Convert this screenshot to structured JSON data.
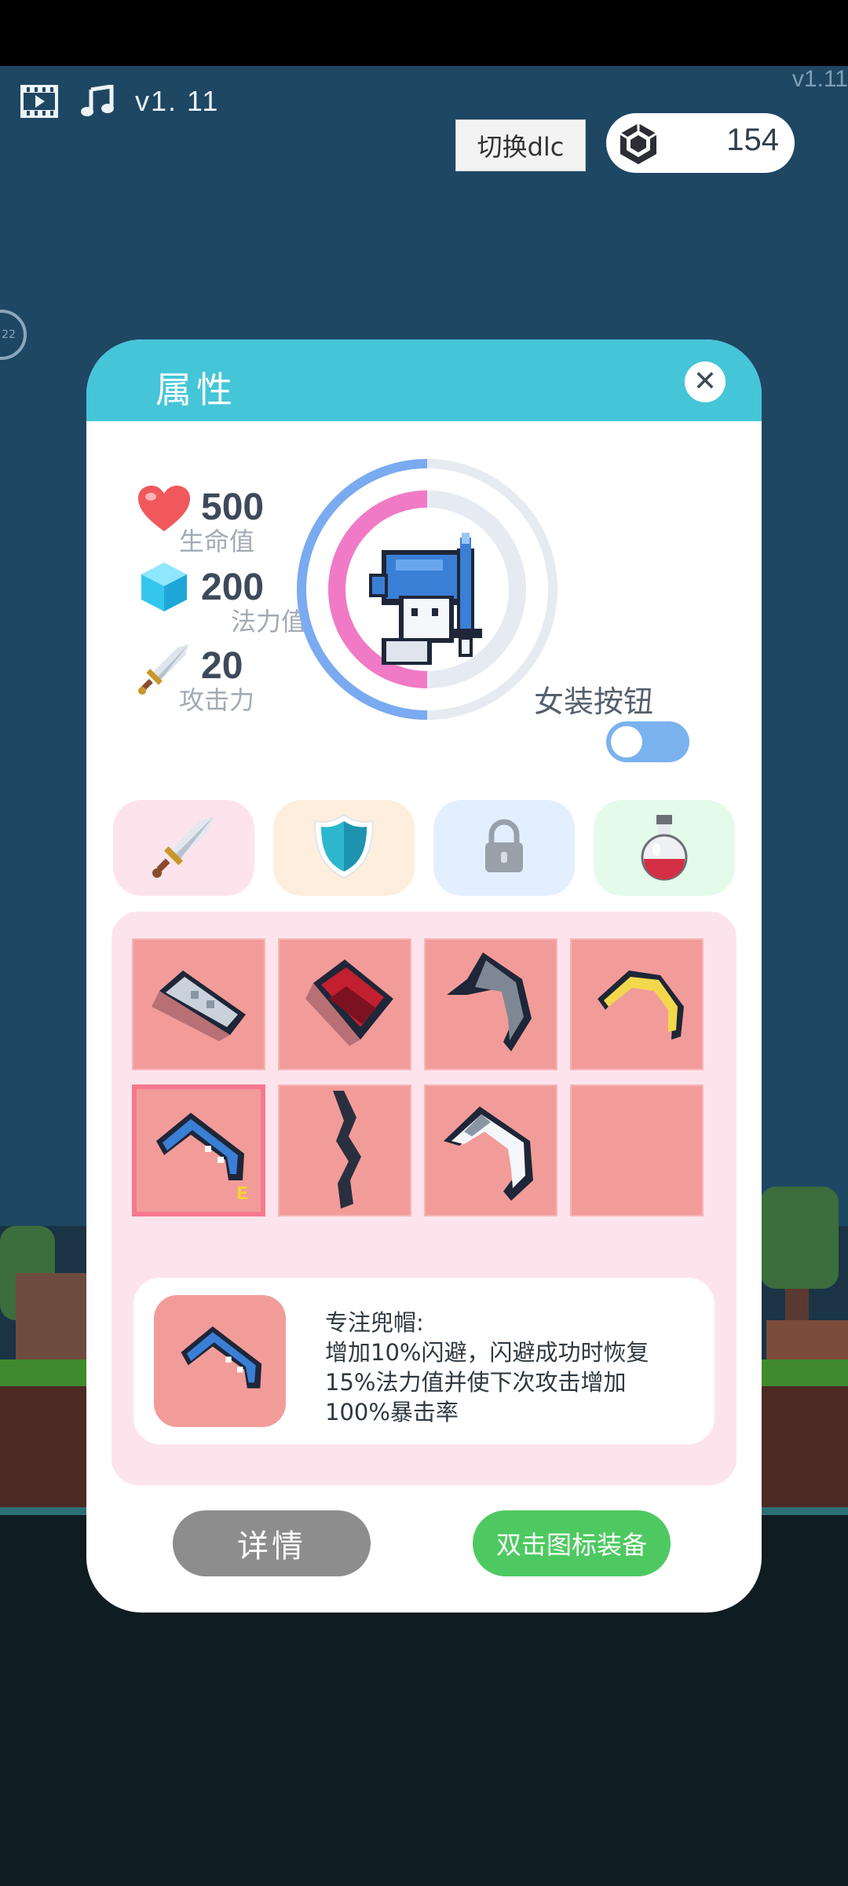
{
  "hud": {
    "version_left": "v1. 11",
    "version_right": "v1.11",
    "dlc_button": "切换dlc",
    "currency_count": "154",
    "side_badge": "22"
  },
  "dialog": {
    "title": "属性",
    "close_icon": "close-icon",
    "stats": {
      "hp": {
        "value": "500",
        "label": "生命值"
      },
      "mp": {
        "value": "200",
        "label": "法力值"
      },
      "atk": {
        "value": "20",
        "label": "攻击力"
      }
    },
    "costume_toggle_label": "女装按钮",
    "costume_toggle_on": false,
    "tabs": [
      {
        "name": "weapon",
        "icon": "sword-icon",
        "color": "#fde4ec"
      },
      {
        "name": "armor",
        "icon": "shield-icon",
        "color": "#fdeede"
      },
      {
        "name": "locked",
        "icon": "lock-icon",
        "color": "#e3efff"
      },
      {
        "name": "potion",
        "icon": "potion-icon",
        "color": "#e4fbe9"
      }
    ],
    "inventory": [
      {
        "icon": "silver-cap-icon"
      },
      {
        "icon": "red-helmet-icon"
      },
      {
        "icon": "dark-hood-icon"
      },
      {
        "icon": "gold-band-icon"
      },
      {
        "icon": "blue-hood-icon",
        "selected": true,
        "level": "E"
      },
      {
        "icon": "dark-feather-icon"
      },
      {
        "icon": "white-hood-icon"
      },
      {
        "icon": "empty-slot"
      }
    ],
    "description": {
      "title": "专注兜帽:",
      "line1": "增加10%闪避，闪避成功时恢复",
      "line2": "15%法力值并使下次攻击增加",
      "line3": "100%暴击率"
    },
    "details_button": "详情",
    "equip_button": "双击图标装备"
  },
  "colors": {
    "header": "#45c5d8",
    "equip": "#4ec961",
    "details": "#8d8d8d",
    "slot": "#f29c9a",
    "ring_hp": "#f07ac6",
    "ring_mp": "#7aaaf0"
  }
}
